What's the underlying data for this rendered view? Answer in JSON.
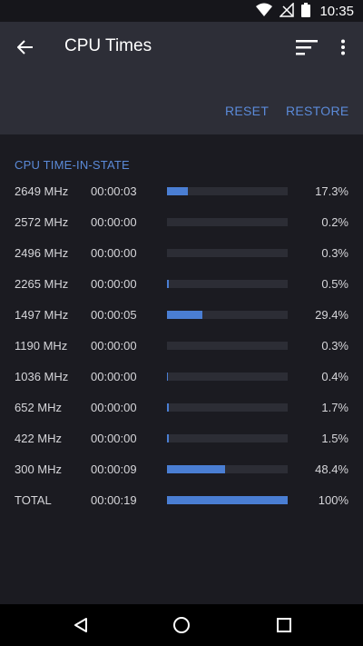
{
  "status_bar": {
    "time": "10:35",
    "icons": [
      "wifi-icon",
      "no-signal-icon",
      "battery-icon"
    ]
  },
  "app_bar": {
    "title": "CPU Times",
    "back_icon": "arrow-back-icon",
    "sort_icon": "sort-icon",
    "more_icon": "more-vert-icon"
  },
  "actions": {
    "reset": "RESET",
    "restore": "RESTORE"
  },
  "section": {
    "header": "CPU TIME-IN-STATE"
  },
  "rows": [
    {
      "freq": "2649 MHz",
      "time": "00:00:03",
      "pct": "17.3%",
      "fraction": 0.173
    },
    {
      "freq": "2572 MHz",
      "time": "00:00:00",
      "pct": "0.2%",
      "fraction": 0.002
    },
    {
      "freq": "2496 MHz",
      "time": "00:00:00",
      "pct": "0.3%",
      "fraction": 0.003
    },
    {
      "freq": "2265 MHz",
      "time": "00:00:00",
      "pct": "0.5%",
      "fraction": 0.005
    },
    {
      "freq": "1497 MHz",
      "time": "00:00:05",
      "pct": "29.4%",
      "fraction": 0.294
    },
    {
      "freq": "1190 MHz",
      "time": "00:00:00",
      "pct": "0.3%",
      "fraction": 0.003
    },
    {
      "freq": "1036 MHz",
      "time": "00:00:00",
      "pct": "0.4%",
      "fraction": 0.004
    },
    {
      "freq": "652 MHz",
      "time": "00:00:00",
      "pct": "1.7%",
      "fraction": 0.017
    },
    {
      "freq": "422 MHz",
      "time": "00:00:00",
      "pct": "1.5%",
      "fraction": 0.015
    },
    {
      "freq": "300 MHz",
      "time": "00:00:09",
      "pct": "48.4%",
      "fraction": 0.484
    },
    {
      "freq": "TOTAL",
      "time": "00:00:19",
      "pct": "100%",
      "fraction": 1.0
    }
  ],
  "colors": {
    "accent": "#5b8ad8",
    "bar_fill": "#4a7ed3",
    "bar_track": "#2c2d35",
    "app_bar": "#2d2e37",
    "background": "#1b1b21"
  },
  "nav_bar": {
    "icons": [
      "back-triangle-icon",
      "home-circle-icon",
      "recents-square-icon"
    ]
  }
}
